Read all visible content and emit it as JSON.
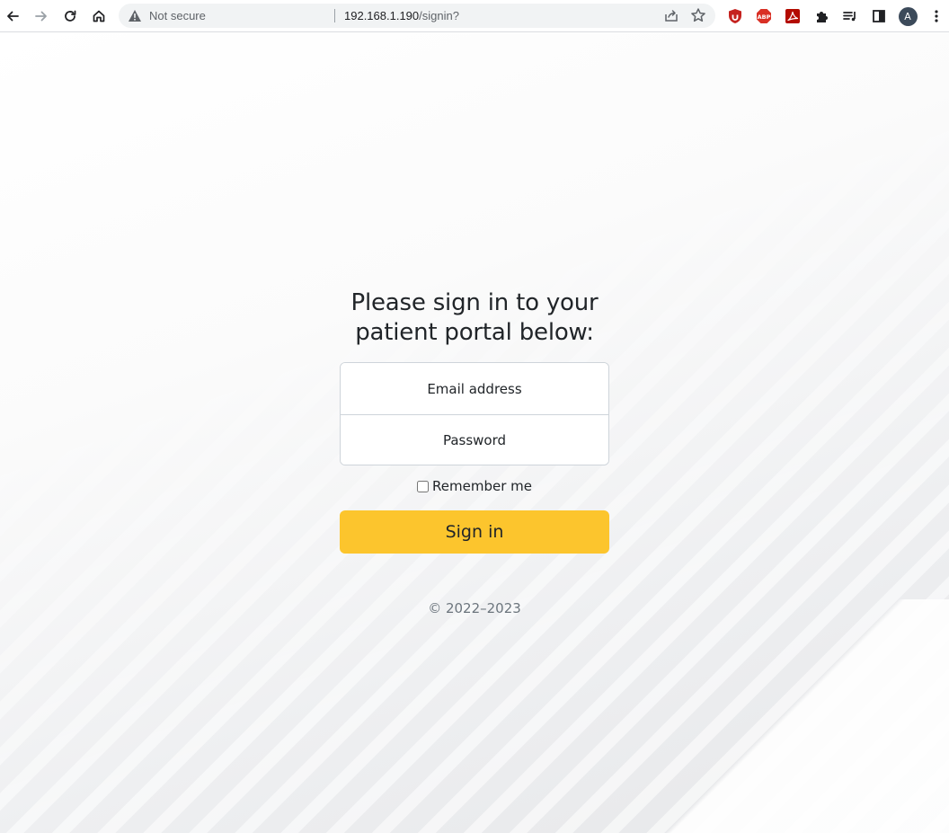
{
  "browser": {
    "security_label": "Not secure",
    "url_host": "192.168.1.190",
    "url_path": "/signin?",
    "profile_initial": "A",
    "icons": [
      "back-icon",
      "forward-icon",
      "reload-icon",
      "home-icon",
      "warning-icon",
      "share-icon",
      "star-icon",
      "ublock-icon",
      "adblock-plus-icon",
      "acrobat-icon",
      "extensions-icon",
      "media-controls-icon",
      "side-panel-icon",
      "kebab-menu-icon"
    ],
    "extensions": {
      "adblock_text": "ABP"
    }
  },
  "login": {
    "heading_line1": "Please sign in to your",
    "heading_line2": "patient portal below:",
    "email_placeholder": "Email address",
    "password_placeholder": "Password",
    "remember_label": "Remember me",
    "remember_checked": false,
    "submit_label": "Sign in",
    "copyright": "© 2022–2023"
  },
  "colors": {
    "accent": "#fcc52d",
    "text": "#212529",
    "muted": "#6c757d"
  }
}
